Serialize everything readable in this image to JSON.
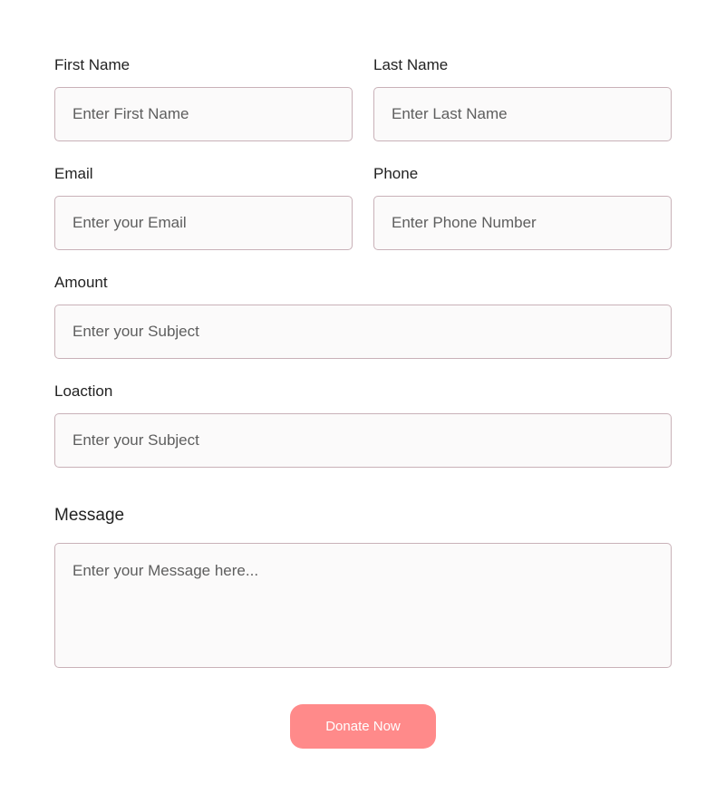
{
  "form": {
    "first_name": {
      "label": "First Name",
      "placeholder": "Enter First Name"
    },
    "last_name": {
      "label": "Last Name",
      "placeholder": "Enter Last Name"
    },
    "email": {
      "label": "Email",
      "placeholder": "Enter your Email"
    },
    "phone": {
      "label": "Phone",
      "placeholder": "Enter Phone Number"
    },
    "amount": {
      "label": "Amount",
      "placeholder": "Enter your Subject"
    },
    "location": {
      "label": "Loaction",
      "placeholder": "Enter your Subject"
    },
    "message": {
      "label": "Message",
      "placeholder": "Enter your Message here..."
    },
    "submit_label": "Donate Now"
  },
  "colors": {
    "input_border": "#c9b1b8",
    "input_background": "#fbfafa",
    "button_background": "#ff8a8a",
    "button_text": "#ffffff"
  }
}
